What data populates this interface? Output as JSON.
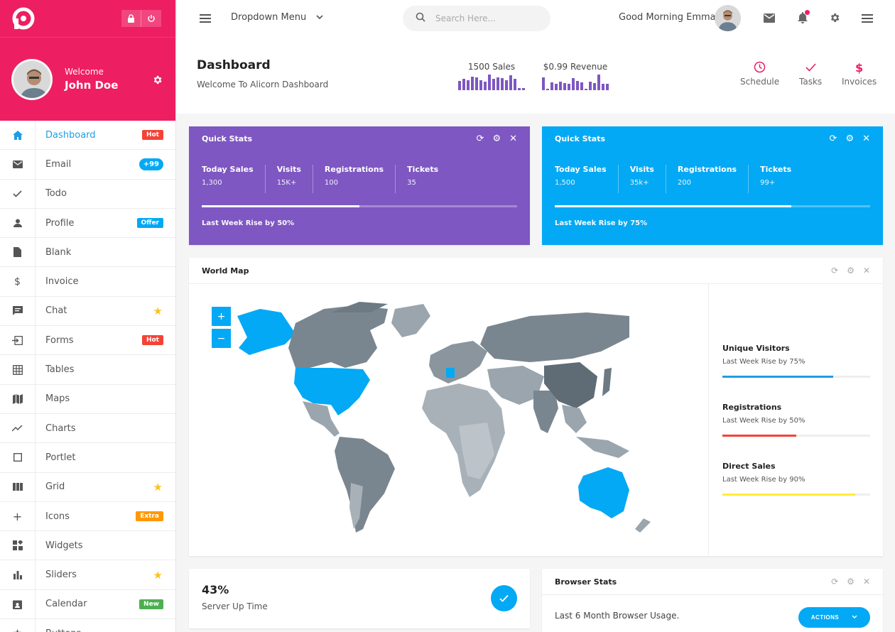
{
  "sidebar": {
    "user": {
      "welcome": "Welcome",
      "name": "John Doe"
    },
    "items": [
      {
        "label": "Dashboard",
        "icon": "home-icon",
        "badge": "Hot",
        "badge_color": "#f44336",
        "active": true
      },
      {
        "label": "Email",
        "icon": "mail-icon",
        "badge": "+99",
        "badge_color": "#03a9f4",
        "pill": true
      },
      {
        "label": "Todo",
        "icon": "check-icon"
      },
      {
        "label": "Profile",
        "icon": "person-icon",
        "badge": "Offer",
        "badge_color": "#03a9f4"
      },
      {
        "label": "Blank",
        "icon": "file-icon"
      },
      {
        "label": "Invoice",
        "icon": "dollar-icon"
      },
      {
        "label": "Chat",
        "icon": "chat-icon",
        "star": true
      },
      {
        "label": "Forms",
        "icon": "input-icon",
        "badge": "Hot",
        "badge_color": "#f44336"
      },
      {
        "label": "Tables",
        "icon": "table-icon"
      },
      {
        "label": "Maps",
        "icon": "map-icon"
      },
      {
        "label": "Charts",
        "icon": "trending-icon"
      },
      {
        "label": "Portlet",
        "icon": "square-icon"
      },
      {
        "label": "Grid",
        "icon": "grid-icon",
        "star": true
      },
      {
        "label": "Icons",
        "icon": "plus-icon",
        "badge": "Extra",
        "badge_color": "#ff9800"
      },
      {
        "label": "Widgets",
        "icon": "widgets-icon"
      },
      {
        "label": "Sliders",
        "icon": "bars-icon",
        "star": true
      },
      {
        "label": "Calendar",
        "icon": "calendar-icon",
        "badge": "New",
        "badge_color": "#4caf50"
      },
      {
        "label": "Buttons",
        "icon": "star-icon"
      }
    ]
  },
  "topbar": {
    "dropdown_label": "Dropdown Menu",
    "search_placeholder": "Search Here...",
    "greeting": "Good Morning Emma."
  },
  "header": {
    "title": "Dashboard",
    "subtitle": "Welcome To Alicorn Dashboard",
    "sales_label": "1500 Sales",
    "revenue_label": "$0.99 Revenue",
    "sales_bars": [
      50,
      60,
      55,
      75,
      70,
      55,
      45,
      85,
      60,
      70,
      65,
      55,
      80,
      60,
      10,
      10
    ],
    "revenue_bars": [
      80,
      10,
      50,
      40,
      55,
      45,
      40,
      75,
      60,
      50,
      10,
      55,
      45,
      100,
      40,
      40
    ],
    "actions": [
      {
        "label": "Schedule",
        "icon": "clock-icon"
      },
      {
        "label": "Tasks",
        "icon": "check-icon"
      },
      {
        "label": "Invoices",
        "icon": "dollar-icon"
      }
    ]
  },
  "quick_stats": [
    {
      "title": "Quick Stats",
      "color": "#7e57c2",
      "cols": [
        {
          "k": "Today Sales",
          "v": "1,300"
        },
        {
          "k": "Visits",
          "v": "15K+"
        },
        {
          "k": "Registrations",
          "v": "100"
        },
        {
          "k": "Tickets",
          "v": "35"
        }
      ],
      "progress": 0.5,
      "footer": "Last Week Rise by 50%"
    },
    {
      "title": "Quick Stats",
      "color": "#03a9f4",
      "cols": [
        {
          "k": "Today Sales",
          "v": "1,500"
        },
        {
          "k": "Visits",
          "v": "35k+"
        },
        {
          "k": "Registrations",
          "v": "200"
        },
        {
          "k": "Tickets",
          "v": "99+"
        }
      ],
      "progress": 0.75,
      "footer": "Last Week Rise by 75%"
    }
  ],
  "world_map": {
    "title": "World Map",
    "zoom_in": "+",
    "zoom_out": "−",
    "stats": [
      {
        "k": "Unique Visitors",
        "v": "Last Week Rise by 75%",
        "progress": 0.75,
        "color": "#1e9ee6"
      },
      {
        "k": "Registrations",
        "v": "Last Week Rise by 50%",
        "progress": 0.5,
        "color": "#f44336"
      },
      {
        "k": "Direct Sales",
        "v": "Last Week Rise by 90%",
        "progress": 0.9,
        "color": "#ffeb3b"
      }
    ]
  },
  "uptime": {
    "value": "43%",
    "label": "Server Up Time"
  },
  "browser_stats": {
    "title": "Browser Stats",
    "desc": "Last 6 Month Browser Usage.",
    "action_label": "ACTIONS"
  },
  "colors": {
    "brand": "#ee1e63",
    "accent": "#03a9f4",
    "purple": "#7e57c2"
  }
}
